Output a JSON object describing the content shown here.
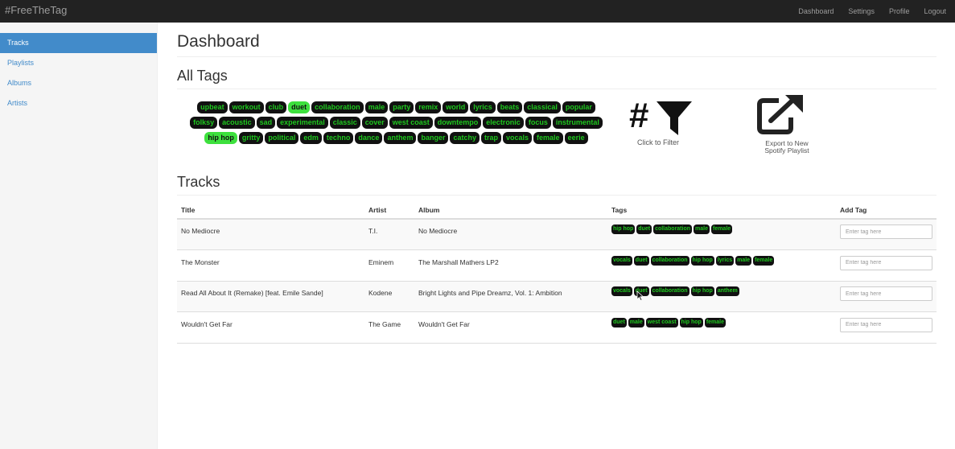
{
  "navbar": {
    "brand": "#FreeTheTag",
    "links": [
      "Dashboard",
      "Settings",
      "Profile",
      "Logout"
    ]
  },
  "sidebar": {
    "items": [
      {
        "label": "Tracks",
        "active": true
      },
      {
        "label": "Playlists",
        "active": false
      },
      {
        "label": "Albums",
        "active": false
      },
      {
        "label": "Artists",
        "active": false
      }
    ]
  },
  "main": {
    "title": "Dashboard",
    "all_tags_heading": "All Tags",
    "tracks_heading": "Tracks",
    "filter_caption": "Click to Filter",
    "filter_hash": "#",
    "export_caption_line1": "Export to New",
    "export_caption_line2": "Spotify Playlist"
  },
  "all_tags": [
    [
      {
        "label": "upbeat",
        "selected": false
      },
      {
        "label": "workout",
        "selected": false
      },
      {
        "label": "club",
        "selected": false
      },
      {
        "label": "duet",
        "selected": true
      },
      {
        "label": "collaboration",
        "selected": false
      },
      {
        "label": "male",
        "selected": false
      },
      {
        "label": "party",
        "selected": false
      },
      {
        "label": "remix",
        "selected": false
      },
      {
        "label": "world",
        "selected": false
      },
      {
        "label": "lyrics",
        "selected": false
      },
      {
        "label": "beats",
        "selected": false
      },
      {
        "label": "classical",
        "selected": false
      },
      {
        "label": "popular",
        "selected": false
      }
    ],
    [
      {
        "label": "folksy",
        "selected": false
      },
      {
        "label": "acoustic",
        "selected": false
      },
      {
        "label": "sad",
        "selected": false
      },
      {
        "label": "experimental",
        "selected": false
      },
      {
        "label": "classic",
        "selected": false
      },
      {
        "label": "cover",
        "selected": false
      },
      {
        "label": "west coast",
        "selected": false
      },
      {
        "label": "downtempo",
        "selected": false
      },
      {
        "label": "electronic",
        "selected": false
      },
      {
        "label": "focus",
        "selected": false
      },
      {
        "label": "instrumental",
        "selected": false
      }
    ],
    [
      {
        "label": "hip hop",
        "selected": true
      },
      {
        "label": "gritty",
        "selected": false
      },
      {
        "label": "political",
        "selected": false
      },
      {
        "label": "edm",
        "selected": false
      },
      {
        "label": "techno",
        "selected": false
      },
      {
        "label": "dance",
        "selected": false
      },
      {
        "label": "anthem",
        "selected": false
      },
      {
        "label": "banger",
        "selected": false
      },
      {
        "label": "catchy",
        "selected": false
      },
      {
        "label": "trap",
        "selected": false
      },
      {
        "label": "vocals",
        "selected": false
      },
      {
        "label": "female",
        "selected": false
      },
      {
        "label": "eerie",
        "selected": false
      }
    ]
  ],
  "table": {
    "headers": {
      "title": "Title",
      "artist": "Artist",
      "album": "Album",
      "tags": "Tags",
      "add_tag": "Add Tag"
    },
    "add_tag_placeholder": "Enter tag here",
    "rows": [
      {
        "title": "No Mediocre",
        "artist": "T.I.",
        "album": "No Mediocre",
        "tags": [
          "hip hop",
          "duet",
          "collaboration",
          "male",
          "female"
        ]
      },
      {
        "title": "The Monster",
        "artist": "Eminem",
        "album": "The Marshall Mathers LP2",
        "tags": [
          "vocals",
          "duet",
          "collaboration",
          "hip hop",
          "lyrics",
          "male",
          "female"
        ]
      },
      {
        "title": "Read All About It (Remake) [feat. Emile Sande]",
        "artist": "Kodene",
        "album": "Bright Lights and Pipe Dreamz, Vol. 1: Ambition",
        "tags": [
          "vocals",
          "duet",
          "collaboration",
          "hip hop",
          "anthem"
        ]
      },
      {
        "title": "Wouldn't Get Far",
        "artist": "The Game",
        "album": "Wouldn't Get Far",
        "tags": [
          "duet",
          "male",
          "west coast",
          "hip hop",
          "female"
        ]
      }
    ]
  },
  "colors": {
    "navbar_bg": "#222222",
    "sidebar_active": "#428bca",
    "tag_bg": "#111111",
    "tag_text": "#1ec71e",
    "tag_selected_bg": "#3de03d"
  }
}
